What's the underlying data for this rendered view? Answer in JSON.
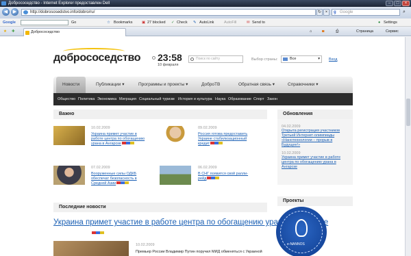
{
  "window": {
    "title": "Добрососедство - Internet Explorer предоставлен Dell"
  },
  "address": {
    "url": "http://dobrososedstvo.info/dobro/ru/",
    "search_placeholder": "Google"
  },
  "toolbar": {
    "google_label": "Google",
    "go": "Go",
    "bookmarks": "Bookmarks",
    "blocked": "27 blocked",
    "check": "Check",
    "autolink": "AutoLink",
    "autofill": "AutoFill",
    "sendto": "Send to",
    "settings": "Settings"
  },
  "tab": {
    "label": "Добрососедство",
    "page": "Страница",
    "tools": "Сервис"
  },
  "site": {
    "logo": "добрососедство",
    "time": "23:58",
    "date": "10 февраля",
    "search_placeholder": "Поиск по сайту",
    "country_label": "Выбор страны:",
    "country_value": "Все",
    "enter": "Вход"
  },
  "menu": {
    "items": [
      "Новости",
      "Публикации",
      "Программы и проекты",
      "ДоброТВ",
      "Обратная связь",
      "Справочники"
    ],
    "sub": [
      "Общество",
      "Политика",
      "Экономика",
      "Миграция",
      "Социальный туризм",
      "История и культура",
      "Наука",
      "Образование",
      "Спорт",
      "Закон"
    ]
  },
  "important": {
    "title": "Важно",
    "items": [
      {
        "date": "10.02.2009",
        "text": "Украина примет участие в работе центра по обогащению урана в Ангарске"
      },
      {
        "date": "09.02.2009",
        "text": "Россия готова предоставить Украине стабилизационный кредит"
      },
      {
        "date": "07.02.2009",
        "text": "Вооруженные силы ОДКБ обеспечат безопасность в Средней Азии"
      },
      {
        "date": "06.02.2009",
        "text": "В СНГ появится свой ралли-рейд"
      }
    ]
  },
  "updates": {
    "title": "Обновления",
    "items": [
      {
        "date": "04.02.2009",
        "text": "Открыта регистрация участников Третьей Интернет-олимпиады «Нанотехнологии – прорыв в Будущее!»"
      },
      {
        "date": "10.02.2009",
        "text": "Украина примет участие в работе центра по обогащению урана в Ангарске"
      }
    ]
  },
  "latest": {
    "title": "Последние новости",
    "headline": "Украина примет участие в работе центра по обогащению урана в Ангарске",
    "date": "10.02.2009",
    "text": "Премьер России Владимир Путин поручил МИД обменяться с Украиной"
  },
  "projects": {
    "title": "Проекты",
    "logo_text": "e-NANNOS"
  },
  "colors": {
    "accent": "#f4c20d",
    "link": "#1a5fb4",
    "submenu_bg": "#2c2c2c"
  }
}
